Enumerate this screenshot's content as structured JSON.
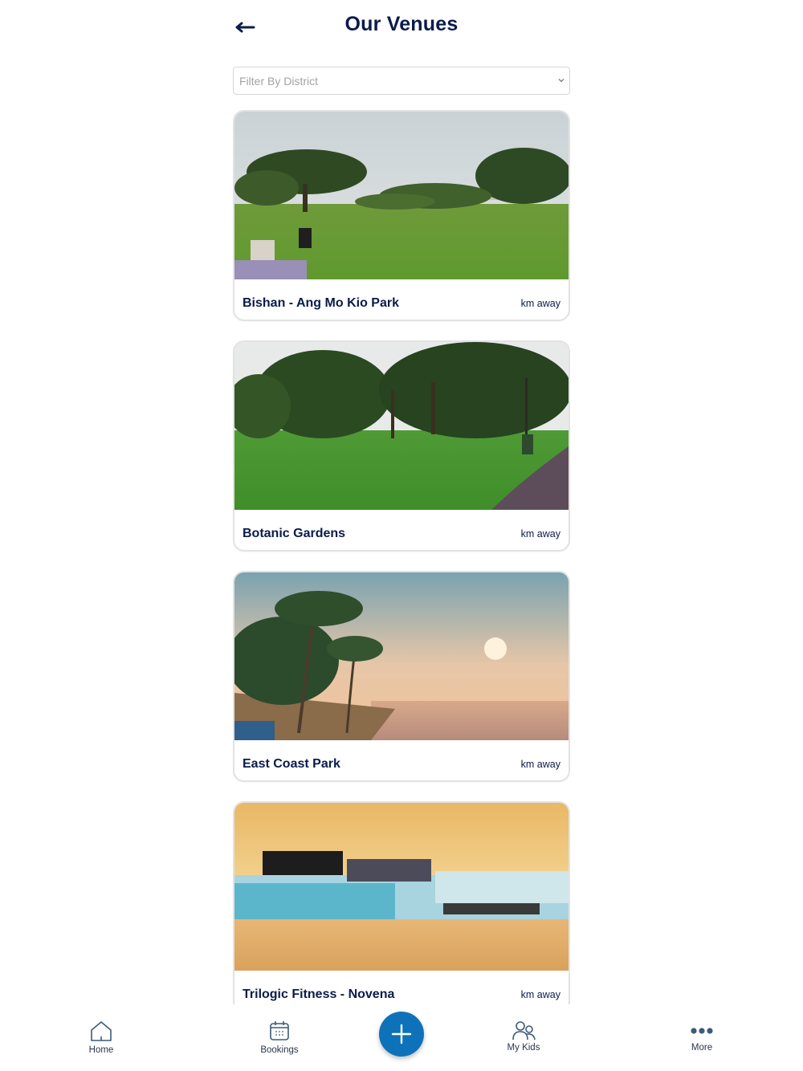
{
  "header": {
    "title": "Our Venues",
    "back_icon": "arrow-left-icon"
  },
  "filter": {
    "placeholder": "Filter By District",
    "icon": "chevron-down-icon"
  },
  "venues": [
    {
      "name": "Bishan - Ang Mo Kio Park",
      "distance": "km away",
      "image": "park-lawn-photo"
    },
    {
      "name": "Botanic Gardens",
      "distance": "km away",
      "image": "garden-lawn-photo"
    },
    {
      "name": "East Coast Park",
      "distance": "km away",
      "image": "beach-sunset-photo"
    },
    {
      "name": "Trilogic Fitness - Novena",
      "distance": "km away",
      "image": "fitness-hall-photo"
    }
  ],
  "tabbar": {
    "items": [
      {
        "label": "Home",
        "icon": "home-icon"
      },
      {
        "label": "Bookings",
        "icon": "calendar-icon"
      },
      {
        "label": "My Kids",
        "icon": "users-icon"
      },
      {
        "label": "More",
        "icon": "more-dots-icon"
      }
    ],
    "fab_icon": "plus-icon"
  },
  "colors": {
    "primary": "#0b1b4a",
    "accent": "#0d72b9",
    "border": "#e2e2e2",
    "placeholder": "#a3a3a3"
  }
}
